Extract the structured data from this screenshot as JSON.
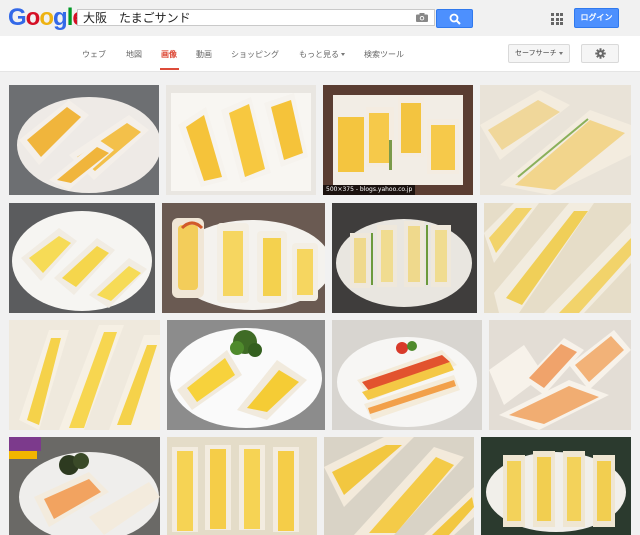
{
  "header": {
    "logo_letters": [
      "G",
      "o",
      "o",
      "g",
      "l",
      "e"
    ],
    "search_query": "大阪　たまごサンド",
    "login_label": "ログイン"
  },
  "nav": {
    "tabs": [
      "ウェブ",
      "地図",
      "画像",
      "動画",
      "ショッピング",
      "もっと見る",
      "検索ツール"
    ],
    "active_tab": "画像",
    "safesearch_label": "セーフサーチ"
  },
  "results": {
    "caption": "500×375 - blogs.yahoo.co.jp",
    "count": 16
  },
  "colors": {
    "logo": [
      "#3369e8",
      "#d50f25",
      "#eeb211",
      "#3369e8",
      "#009925",
      "#d50f25"
    ],
    "accent_blue": "#4d90fe",
    "active_tab": "#dd4b39"
  }
}
